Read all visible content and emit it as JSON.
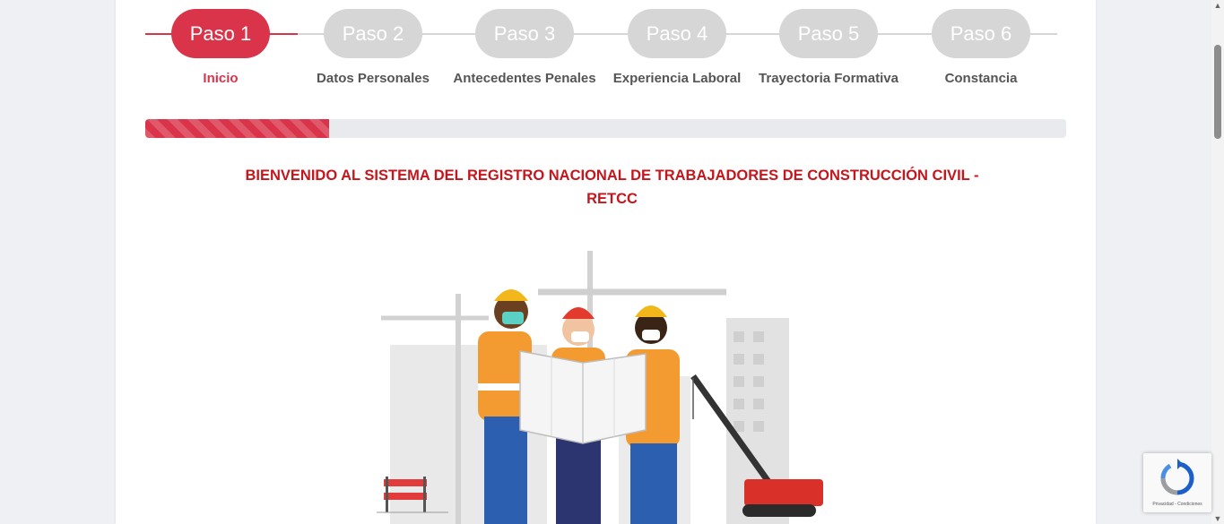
{
  "steps": [
    {
      "badge": "Paso 1",
      "label": "Inicio",
      "active": true
    },
    {
      "badge": "Paso 2",
      "label": "Datos Personales",
      "active": false
    },
    {
      "badge": "Paso 3",
      "label": "Antecedentes Penales",
      "active": false
    },
    {
      "badge": "Paso 4",
      "label": "Experiencia Laboral",
      "active": false
    },
    {
      "badge": "Paso 5",
      "label": "Trayectoria Formativa",
      "active": false
    },
    {
      "badge": "Paso 6",
      "label": "Constancia",
      "active": false
    }
  ],
  "progress_fraction": 0.2,
  "welcome_line1": "BIENVENIDO AL SISTEMA DEL REGISTRO NACIONAL DE TRABAJADORES DE CONSTRUCCIÓN CIVIL -",
  "welcome_line2": "RETCC",
  "recaptcha": {
    "footer": "Privacidad - Condiciones"
  },
  "colors": {
    "accent": "#d9344a",
    "title": "#c4161c",
    "inactive": "#d6d6d6"
  }
}
